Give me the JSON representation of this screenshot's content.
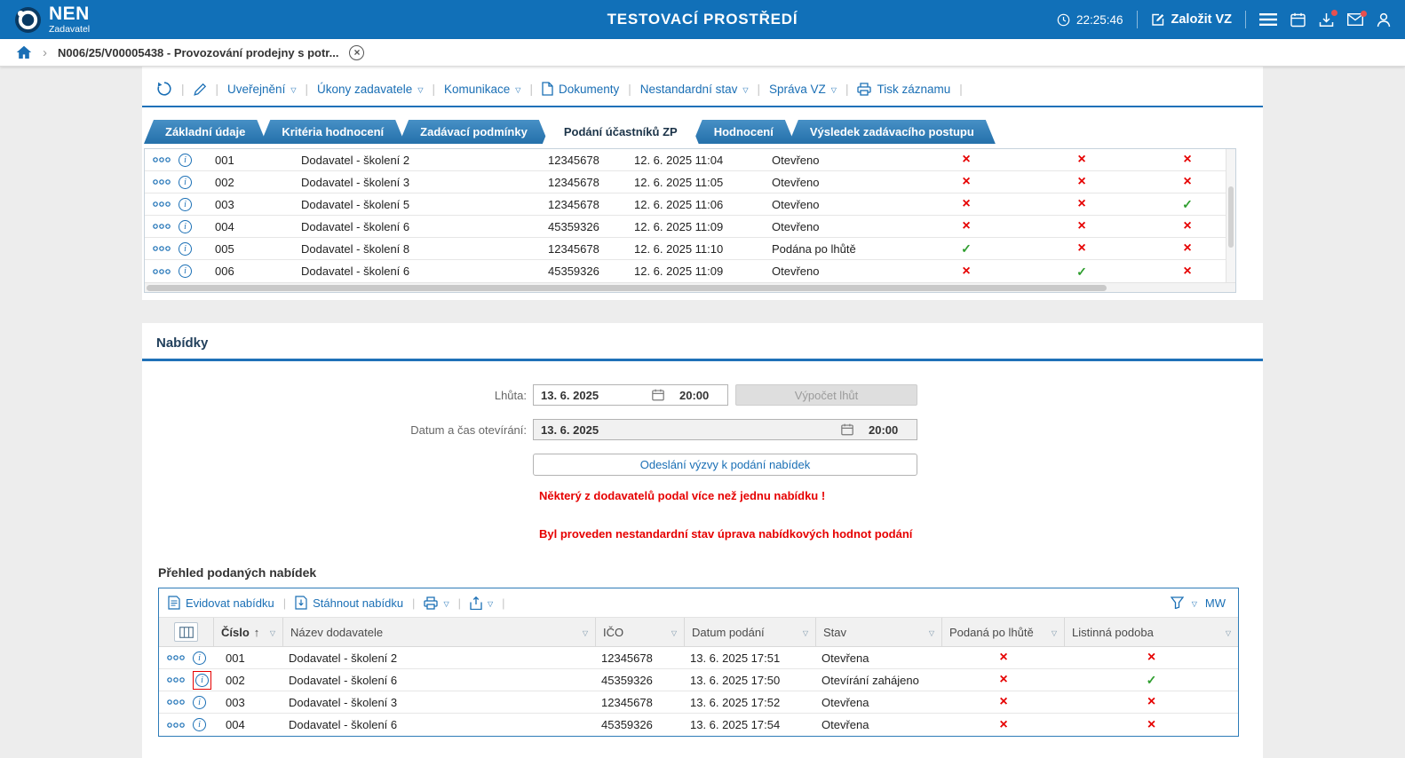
{
  "header": {
    "brand": "NEN",
    "brand_sub": "Zadavatel",
    "env_title": "TESTOVACÍ PROSTŘEDÍ",
    "clock": "22:25:46",
    "create_vz_label": "Založit VZ"
  },
  "breadcrumb": {
    "record": "N006/25/V00005438 - Provozování prodejny s potr..."
  },
  "record_toolbar": {
    "items": [
      {
        "label": "Uveřejnění",
        "dropdown": true,
        "icon": ""
      },
      {
        "label": "Úkony zadavatele",
        "dropdown": true,
        "icon": ""
      },
      {
        "label": "Komunikace",
        "dropdown": true,
        "icon": ""
      },
      {
        "label": "Dokumenty",
        "dropdown": false,
        "icon": "document"
      },
      {
        "label": "Nestandardní stav",
        "dropdown": true,
        "icon": ""
      },
      {
        "label": "Správa VZ",
        "dropdown": true,
        "icon": ""
      },
      {
        "label": "Tisk záznamu",
        "dropdown": false,
        "icon": "printer"
      }
    ]
  },
  "tabs": [
    {
      "label": "Základní údaje",
      "active": false
    },
    {
      "label": "Kritéria hodnocení",
      "active": false
    },
    {
      "label": "Zadávací podmínky",
      "active": false
    },
    {
      "label": "Podání účastníků ZP",
      "active": true
    },
    {
      "label": "Hodnocení",
      "active": false
    },
    {
      "label": "Výsledek zadávacího postupu",
      "active": false
    }
  ],
  "participants_table": {
    "rows": [
      {
        "cislo": "001",
        "dodavatel": "Dodavatel - školení 2",
        "ico": "12345678",
        "datum": "12. 6. 2025 11:04",
        "stav": "Otevřeno",
        "flags": [
          "x",
          "x",
          "x"
        ]
      },
      {
        "cislo": "002",
        "dodavatel": "Dodavatel - školení 3",
        "ico": "12345678",
        "datum": "12. 6. 2025 11:05",
        "stav": "Otevřeno",
        "flags": [
          "x",
          "x",
          "x"
        ]
      },
      {
        "cislo": "003",
        "dodavatel": "Dodavatel - školení 5",
        "ico": "12345678",
        "datum": "12. 6. 2025 11:06",
        "stav": "Otevřeno",
        "flags": [
          "x",
          "x",
          "check"
        ]
      },
      {
        "cislo": "004",
        "dodavatel": "Dodavatel - školení 6",
        "ico": "45359326",
        "datum": "12. 6. 2025 11:09",
        "stav": "Otevřeno",
        "flags": [
          "x",
          "x",
          "x"
        ]
      },
      {
        "cislo": "005",
        "dodavatel": "Dodavatel - školení 8",
        "ico": "12345678",
        "datum": "12. 6. 2025 11:10",
        "stav": "Podána po lhůtě",
        "flags": [
          "check",
          "x",
          "x"
        ]
      },
      {
        "cislo": "006",
        "dodavatel": "Dodavatel - školení 6",
        "ico": "45359326",
        "datum": "12. 6. 2025 11:09",
        "stav": "Otevřeno",
        "flags": [
          "x",
          "check",
          "x"
        ]
      }
    ]
  },
  "offers_section": {
    "title": "Nabídky",
    "form": {
      "lhuta_label": "Lhůta:",
      "lhuta_date": "13. 6. 2025",
      "lhuta_time": "20:00",
      "vypocet_lhut_label": "Výpočet lhůt",
      "oteviranni_label": "Datum a čas otevírání:",
      "oteviranni_date": "13. 6. 2025",
      "oteviranni_time": "20:00",
      "send_request_label": "Odeslání výzvy k podání nabídek"
    },
    "warnings": [
      "Některý z dodavatelů podal více než jednu nabídku !",
      "Byl proveden nestandardní stav úprava nabídkových hodnot podání"
    ]
  },
  "offers_table": {
    "title": "Přehled podaných nabídek",
    "toolbar": {
      "evidovat_label": "Evidovat nabídku",
      "stahnout_label": "Stáhnout nabídku",
      "mw_label": "MW"
    },
    "columns": [
      {
        "label": "Číslo"
      },
      {
        "label": "Název dodavatele"
      },
      {
        "label": "IČO"
      },
      {
        "label": "Datum podání"
      },
      {
        "label": "Stav"
      },
      {
        "label": "Podaná po lhůtě"
      },
      {
        "label": "Listinná podoba"
      }
    ],
    "rows": [
      {
        "cislo": "001",
        "dodavatel": "Dodavatel - školení 2",
        "ico": "12345678",
        "datum": "13. 6. 2025 17:51",
        "stav": "Otevřena",
        "po_lhute": "x",
        "listinna": "x",
        "info_alert": false
      },
      {
        "cislo": "002",
        "dodavatel": "Dodavatel - školení 6",
        "ico": "45359326",
        "datum": "13. 6. 2025 17:50",
        "stav": "Otevírání zahájeno",
        "po_lhute": "x",
        "listinna": "check",
        "info_alert": true
      },
      {
        "cislo": "003",
        "dodavatel": "Dodavatel - školení 3",
        "ico": "12345678",
        "datum": "13. 6. 2025 17:52",
        "stav": "Otevřena",
        "po_lhute": "x",
        "listinna": "x",
        "info_alert": false
      },
      {
        "cislo": "004",
        "dodavatel": "Dodavatel - školení 6",
        "ico": "45359326",
        "datum": "13. 6. 2025 17:54",
        "stav": "Otevřena",
        "po_lhute": "x",
        "listinna": "x",
        "info_alert": false
      }
    ]
  }
}
